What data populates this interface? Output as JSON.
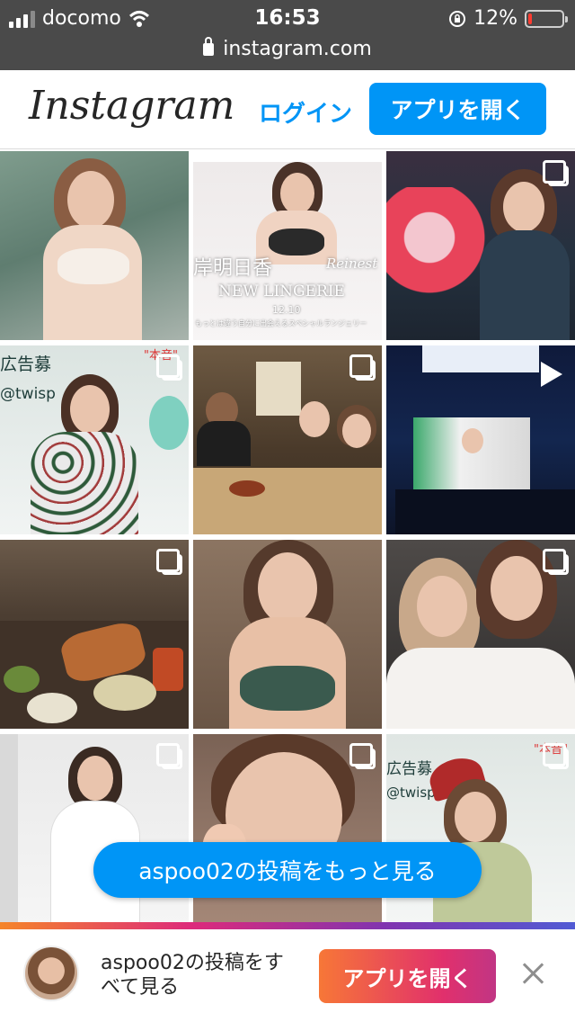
{
  "status_bar": {
    "carrier": "docomo",
    "time": "16:53",
    "battery_percent": "12%",
    "battery_level": 0.12
  },
  "url_bar": {
    "url": "instagram.com"
  },
  "header": {
    "logo_text": "Instagram",
    "login_label": "ログイン",
    "open_app_label": "アプリを開く"
  },
  "grid": {
    "posts": [
      {
        "kind": "photo"
      },
      {
        "kind": "photo",
        "overlay_text": [
          "岸明日香",
          "Reinest",
          "NEW LINGERIE",
          "12.10",
          "もっとは違う自分に出会えるスペシャルランジェリー"
        ]
      },
      {
        "kind": "carousel"
      },
      {
        "kind": "carousel",
        "overlay_text": [
          "広告募",
          "@twisp",
          "\"本音\""
        ]
      },
      {
        "kind": "carousel"
      },
      {
        "kind": "video"
      },
      {
        "kind": "carousel"
      },
      {
        "kind": "photo"
      },
      {
        "kind": "carousel"
      },
      {
        "kind": "carousel"
      },
      {
        "kind": "carousel"
      },
      {
        "kind": "carousel",
        "overlay_text": [
          "広告募",
          "@twisp",
          "\"本音\""
        ]
      }
    ]
  },
  "see_more_label": "aspoo02の投稿をもっと見る",
  "bottom_banner": {
    "text": "aspoo02の投稿をすべて見る",
    "open_app_label": "アプリを開く"
  },
  "colors": {
    "accent": "#0095f6",
    "status_bar_bg": "#4a4a4a",
    "battery_low": "#ff3b30"
  },
  "icons": [
    "wifi-icon",
    "signal-icon",
    "lock-icon",
    "orientation-lock-icon",
    "battery-icon",
    "carousel-icon",
    "video-icon",
    "close-icon"
  ]
}
